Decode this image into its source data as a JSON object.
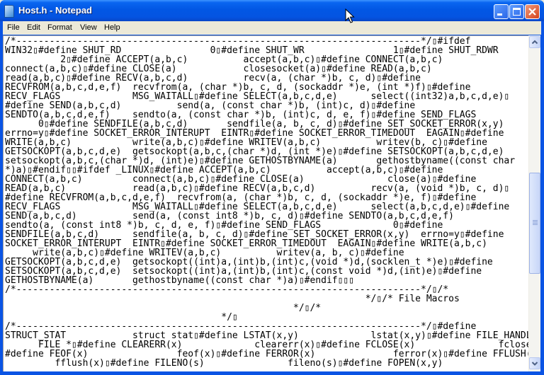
{
  "window": {
    "title": "Host.h - Notepad",
    "icons": {
      "app": "notepad-icon",
      "minimize": "minimize-icon",
      "maximize": "maximize-icon",
      "close": "close-icon"
    }
  },
  "menubar": {
    "items": [
      {
        "label": "File"
      },
      {
        "label": "Edit"
      },
      {
        "label": "Format"
      },
      {
        "label": "View"
      },
      {
        "label": "Help"
      }
    ]
  },
  "editor": {
    "lines": [
      "/*-------------------------------------------------------------------------*/▯#ifdef",
      "WIN32▯#define SHUT_RD                0▯#define SHUT_WR                1▯#define SHUT_RDWR",
      "          2▯#define ACCEPT(a,b,c)          accept(a,b,c)▯#define CONNECT(a,b,c)",
      "connect(a,b,c)▯#define CLOSE(a)            closesocket(a)▯#define READ(a,b,c)",
      "read(a,b,c)▯#define RECV(a,b,c,d)          recv(a, (char *)b, c, d)▯#define",
      "RECVFROM(a,b,c,d,e,f)  recvfrom(a, (char *)b, c, d, (sockaddr *)e, (int *)f)▯#define",
      "RECV_FLAGS             MSG_WAITALL▯#define SELECT(a,b,c,d,e)      select((int32)a,b,c,d,e)▯",
      "#define SEND(a,b,c,d)          send(a, (const char *)b, (int)c, d)▯#define",
      "SENDTO(a,b,c,d,e,f)    sendto(a, (const char *)b, (int)c, d, e, f)▯#define SEND_FLAGS",
      "      0▯#define SENDFILE(a,b,c,d)       sendfile(a, b, c, d)▯#define SET_SOCKET_ERROR(x,y)",
      "errno=y▯#define SOCKET_ERROR_INTERUPT  EINTR▯#define SOCKET_ERROR_TIMEDOUT  EAGAIN▯#define",
      "WRITE(a,b,c)           write(a,b,c)▯#define WRITEV(a,b,c)          writev(b, c)▯#define",
      "GETSOCKOPT(a,b,c,d,e)  getsockopt(a,b,c,(char *)d, (int *)e)▯#define SETSOCKOPT(a,b,c,d,e)",
      "setsockopt(a,b,c,(char *)d, (int)e)▯#define GETHOSTBYNAME(a)       gethostbyname((const char",
      "*)a)▯#endif▯▯#ifdef _LINUX▯#define ACCEPT(a,b,c)          accept(a,b,c)▯#define",
      "CONNECT(a,b,c)         connect(a,b,c)▯#define CLOSE(a)               close(a)▯#define",
      "READ(a,b,c)            read(a,b,c)▯#define RECV(a,b,c,d)          recv(a, (void *)b, c, d)▯",
      "#define RECVFROM(a,b,c,d,e,f)  recvfrom(a, (char *)b, c, d, (sockaddr *)e, f)▯#define",
      "RECV_FLAGS             MSG_WAITALL▯#define SELECT(a,b,c,d,e)      select(a,b,c,d,e)▯#define",
      "SEND(a,b,c,d)          send(a, (const int8 *)b, c, d)▯#define SENDTO(a,b,c,d,e,f)",
      "sendto(a, (const int8 *)b, c, d, e, f)▯#define SEND_FLAGS             0▯#define",
      "SENDFILE(a,b,c,d)      sendfile(a, b, c, d)▯#define SET_SOCKET_ERROR(x,y)  errno=y▯#define",
      "SOCKET_ERROR_INTERUPT  EINTR▯#define SOCKET_ERROR_TIMEDOUT  EAGAIN▯#define WRITE(a,b,c)",
      "     write(a,b,c)▯#define WRITEV(a,b,c)          writev(a, b, c)▯#define",
      "GETSOCKOPT(a,b,c,d,e)  getsockopt((int)a,(int)b,(int)c,(void *)d,(socklen_t *)e)▯#define",
      "SETSOCKOPT(a,b,c,d,e)  setsockopt((int)a,(int)b,(int)c,(const void *)d,(int)e)▯#define",
      "GETHOSTBYNAME(a)       gethostbyname((const char *)a)▯#endif▯▯▯",
      "/*-------------------------------------------------------------------------*/▯/*",
      "                                                                 */▯/* File Macros",
      "                                                    */▯/*",
      "                                       */▯",
      "/*-------------------------------------------------------------------------*/▯#define",
      "STRUCT_STAT            struct stat▯#define LSTAT(x,y)             lstat(x,y)▯#define FILE_HANDLE",
      "      FILE *▯#define CLEARERR(x)             clearerr(x)▯#define FCLOSE(x)               fclose(x)▯",
      "#define FEOF(x)                feof(x)▯#define FERROR(x)              ferror(x)▯#define FFLUSH(x)",
      "         fflush(x)▯#define FILENO(s)               fileno(s)▯#define FOPEN(x,y)"
    ]
  },
  "scrollbar": {
    "up_icon": "scroll-up-arrow-icon",
    "down_icon": "scroll-down-arrow-icon",
    "position_fraction": 0.6
  }
}
